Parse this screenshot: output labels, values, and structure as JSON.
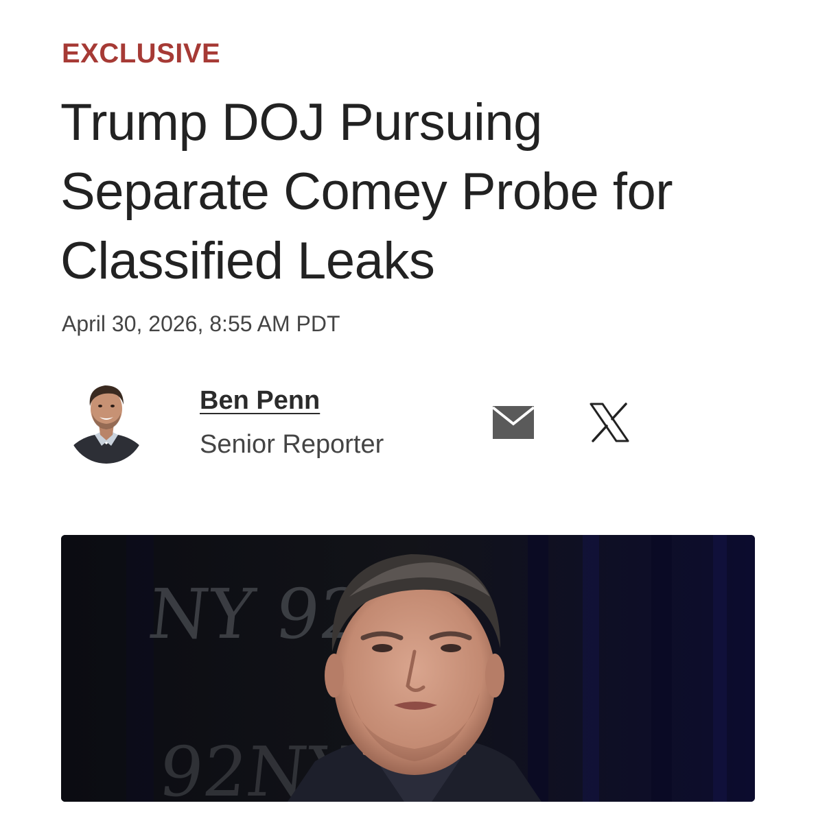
{
  "article": {
    "kicker": "EXCLUSIVE",
    "headline_lines": [
      "Trump DOJ Pursuing",
      "Separate Comey Probe for",
      "Classified Leaks"
    ],
    "dateline": "April 30, 2026, 8:55 AM PDT"
  },
  "author": {
    "name": "Ben Penn",
    "role": "Senior Reporter",
    "avatar_icon": "author-photo",
    "contact_icons": [
      "mail-icon",
      "x-logo-icon"
    ]
  },
  "hero_image": {
    "backdrop_text_top": "NY 92N",
    "backdrop_text_bottom": "92NY 9"
  },
  "colors": {
    "kicker": "#a63a35",
    "headline": "#222222",
    "meta": "#444444",
    "icon": "#555555",
    "hero_bg": "#07070e"
  }
}
